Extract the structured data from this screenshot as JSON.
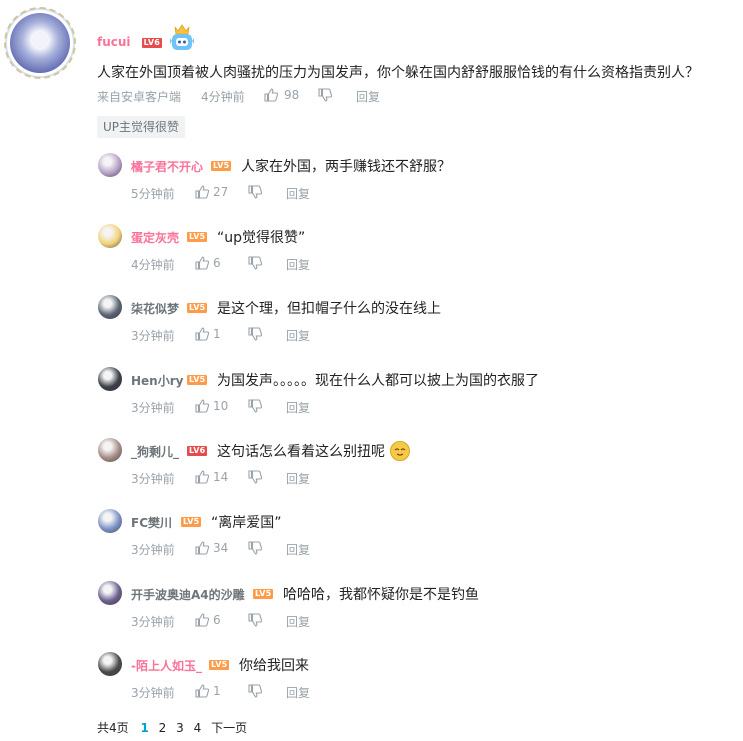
{
  "main": {
    "username": "fucui",
    "level": "LV6",
    "text": "人家在外国顶着被人肉骚扰的压力为国发声，你个躲在国内舒舒服服恰钱的有什么资格指责别人？",
    "source": "来自安卓客户端",
    "time": "4分钟前",
    "likes": "98",
    "reply_label": "回复",
    "up_tag": "UP主觉得很赞"
  },
  "replies": [
    {
      "username": "橘子君不开心",
      "level": "LV5",
      "text": "人家在外国，两手赚钱还不舒服？",
      "time": "5分钟前",
      "likes": "27",
      "reply": "回复",
      "avatar_color": "#b9a2c9"
    },
    {
      "username": "蛋定灰壳",
      "level": "LV5",
      "text": "“up觉得很赞”",
      "time": "4分钟前",
      "likes": "6",
      "reply": "回复",
      "avatar_color": "#f2d27a"
    },
    {
      "username": "柒花似梦",
      "level": "LV5",
      "text": "是这个理，但扣帽子什么的没在线上",
      "time": "3分钟前",
      "likes": "1",
      "reply": "回复",
      "avatar_color": "#5a6474"
    },
    {
      "username": "Hen小ry",
      "level": "LV5",
      "text": "为国发声。。。。。现在什么人都可以披上为国的衣服了",
      "time": "3分钟前",
      "likes": "10",
      "reply": "回复",
      "avatar_color": "#3b3f46"
    },
    {
      "username": "_狗剩儿_",
      "level": "LV6",
      "text": "这句话怎么看着这么别扭呢",
      "time": "3分钟前",
      "likes": "14",
      "reply": "回复",
      "avatar_color": "#a58c86"
    },
    {
      "username": "FC樊川",
      "level": "LV5",
      "text": "“离岸爱国”",
      "time": "3分钟前",
      "likes": "34",
      "reply": "回复",
      "avatar_color": "#7c92c7"
    },
    {
      "username": "开手波奥迪A4的沙雕",
      "level": "LV5",
      "text": "哈哈哈，我都怀疑你是不是钓鱼",
      "time": "3分钟前",
      "likes": "6",
      "reply": "回复",
      "avatar_color": "#6c5f8e"
    },
    {
      "username": "-陌上人如玉_",
      "level": "LV5",
      "text": "你给我回来",
      "time": "3分钟前",
      "likes": "1",
      "reply": "回复",
      "avatar_color": "#4a4a4a"
    }
  ],
  "pager": {
    "total": "共4页",
    "pages": [
      "1",
      "2",
      "3",
      "4"
    ],
    "next": "下一页"
  },
  "colors": {
    "pink_name": "#fb7299",
    "meta": "#99a2aa",
    "accent": "#00a1d6"
  }
}
